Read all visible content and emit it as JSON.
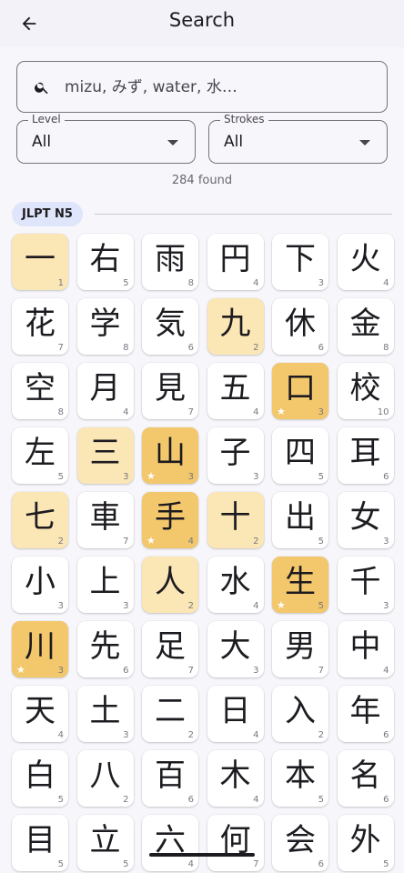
{
  "appbar": {
    "title": "Search",
    "back_icon": "arrow-left-icon"
  },
  "search": {
    "placeholder": "mizu, みず, water, 水…",
    "value": "",
    "icon": "search-icon"
  },
  "filters": {
    "level": {
      "label": "Level",
      "value": "All"
    },
    "strokes": {
      "label": "Strokes",
      "value": "All"
    }
  },
  "results": {
    "found_text": "284 found"
  },
  "group": {
    "label": "JLPT N5"
  },
  "colors": {
    "light_highlight": "#fbe7b6",
    "gold_highlight": "#f3c86c",
    "chip": "#dfe5fa"
  },
  "kanji": [
    {
      "char": "一",
      "strokes": "1",
      "hl": "light",
      "star": false
    },
    {
      "char": "右",
      "strokes": "5",
      "hl": "",
      "star": false
    },
    {
      "char": "雨",
      "strokes": "8",
      "hl": "",
      "star": false
    },
    {
      "char": "円",
      "strokes": "4",
      "hl": "",
      "star": false
    },
    {
      "char": "下",
      "strokes": "3",
      "hl": "",
      "star": false
    },
    {
      "char": "火",
      "strokes": "4",
      "hl": "",
      "star": false
    },
    {
      "char": "花",
      "strokes": "7",
      "hl": "",
      "star": false
    },
    {
      "char": "学",
      "strokes": "8",
      "hl": "",
      "star": false
    },
    {
      "char": "気",
      "strokes": "6",
      "hl": "",
      "star": false
    },
    {
      "char": "九",
      "strokes": "2",
      "hl": "light",
      "star": false
    },
    {
      "char": "休",
      "strokes": "6",
      "hl": "",
      "star": false
    },
    {
      "char": "金",
      "strokes": "8",
      "hl": "",
      "star": false
    },
    {
      "char": "空",
      "strokes": "8",
      "hl": "",
      "star": false
    },
    {
      "char": "月",
      "strokes": "4",
      "hl": "",
      "star": false
    },
    {
      "char": "見",
      "strokes": "7",
      "hl": "",
      "star": false
    },
    {
      "char": "五",
      "strokes": "4",
      "hl": "",
      "star": false
    },
    {
      "char": "口",
      "strokes": "3",
      "hl": "gold",
      "star": true
    },
    {
      "char": "校",
      "strokes": "10",
      "hl": "",
      "star": false
    },
    {
      "char": "左",
      "strokes": "5",
      "hl": "",
      "star": false
    },
    {
      "char": "三",
      "strokes": "3",
      "hl": "light",
      "star": false
    },
    {
      "char": "山",
      "strokes": "3",
      "hl": "gold",
      "star": true
    },
    {
      "char": "子",
      "strokes": "3",
      "hl": "",
      "star": false
    },
    {
      "char": "四",
      "strokes": "5",
      "hl": "",
      "star": false
    },
    {
      "char": "耳",
      "strokes": "6",
      "hl": "",
      "star": false
    },
    {
      "char": "七",
      "strokes": "2",
      "hl": "light",
      "star": false
    },
    {
      "char": "車",
      "strokes": "7",
      "hl": "",
      "star": false
    },
    {
      "char": "手",
      "strokes": "4",
      "hl": "gold",
      "star": true
    },
    {
      "char": "十",
      "strokes": "2",
      "hl": "light",
      "star": false
    },
    {
      "char": "出",
      "strokes": "5",
      "hl": "",
      "star": false
    },
    {
      "char": "女",
      "strokes": "3",
      "hl": "",
      "star": false
    },
    {
      "char": "小",
      "strokes": "3",
      "hl": "",
      "star": false
    },
    {
      "char": "上",
      "strokes": "3",
      "hl": "",
      "star": false
    },
    {
      "char": "人",
      "strokes": "2",
      "hl": "light",
      "star": false
    },
    {
      "char": "水",
      "strokes": "4",
      "hl": "",
      "star": false
    },
    {
      "char": "生",
      "strokes": "5",
      "hl": "gold",
      "star": true
    },
    {
      "char": "千",
      "strokes": "3",
      "hl": "",
      "star": false
    },
    {
      "char": "川",
      "strokes": "3",
      "hl": "gold",
      "star": true
    },
    {
      "char": "先",
      "strokes": "6",
      "hl": "",
      "star": false
    },
    {
      "char": "足",
      "strokes": "7",
      "hl": "",
      "star": false
    },
    {
      "char": "大",
      "strokes": "3",
      "hl": "",
      "star": false
    },
    {
      "char": "男",
      "strokes": "7",
      "hl": "",
      "star": false
    },
    {
      "char": "中",
      "strokes": "4",
      "hl": "",
      "star": false
    },
    {
      "char": "天",
      "strokes": "4",
      "hl": "",
      "star": false
    },
    {
      "char": "土",
      "strokes": "3",
      "hl": "",
      "star": false
    },
    {
      "char": "二",
      "strokes": "2",
      "hl": "",
      "star": false
    },
    {
      "char": "日",
      "strokes": "4",
      "hl": "",
      "star": false
    },
    {
      "char": "入",
      "strokes": "2",
      "hl": "",
      "star": false
    },
    {
      "char": "年",
      "strokes": "6",
      "hl": "",
      "star": false
    },
    {
      "char": "白",
      "strokes": "5",
      "hl": "",
      "star": false
    },
    {
      "char": "八",
      "strokes": "2",
      "hl": "",
      "star": false
    },
    {
      "char": "百",
      "strokes": "6",
      "hl": "",
      "star": false
    },
    {
      "char": "木",
      "strokes": "4",
      "hl": "",
      "star": false
    },
    {
      "char": "本",
      "strokes": "5",
      "hl": "",
      "star": false
    },
    {
      "char": "名",
      "strokes": "6",
      "hl": "",
      "star": false
    },
    {
      "char": "目",
      "strokes": "5",
      "hl": "",
      "star": false
    },
    {
      "char": "立",
      "strokes": "5",
      "hl": "",
      "star": false
    },
    {
      "char": "六",
      "strokes": "4",
      "hl": "",
      "star": false
    },
    {
      "char": "何",
      "strokes": "7",
      "hl": "",
      "star": false
    },
    {
      "char": "会",
      "strokes": "6",
      "hl": "",
      "star": false
    },
    {
      "char": "外",
      "strokes": "5",
      "hl": "",
      "star": false
    }
  ]
}
